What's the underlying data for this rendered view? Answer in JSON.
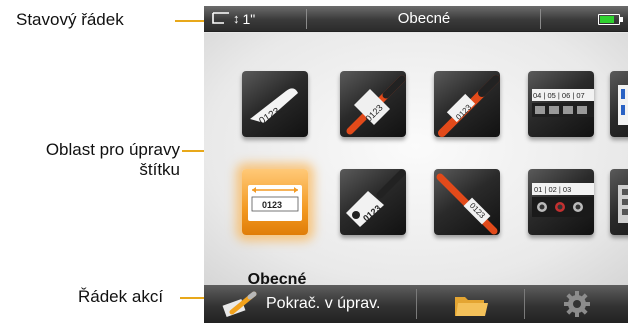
{
  "callouts": {
    "status_bar": "Stavový řádek",
    "edit_area_line1": "Oblast pro úpravy",
    "edit_area_line2": "štítku",
    "action_bar": "Řádek akcí"
  },
  "status_bar": {
    "label_indicator": "1\"",
    "title": "Obecné",
    "battery_level": 0.85
  },
  "edit_area": {
    "selected_caption": "Obecné",
    "tiles": [
      {
        "name": "flag-label-tile",
        "text": "0123..."
      },
      {
        "name": "flag-wrap-tile",
        "text": "0123"
      },
      {
        "name": "cable-wrap-tile",
        "text": "0123"
      },
      {
        "name": "patch-panel-tile",
        "text": "04 | 05 | 06 | 07"
      },
      {
        "name": "punch-down-tile",
        "text": ""
      },
      {
        "name": "general-tile",
        "text": "0123"
      },
      {
        "name": "flag-tag-tile",
        "text": "0123"
      },
      {
        "name": "heat-shrink-tile",
        "text": "0123"
      },
      {
        "name": "terminal-block-tile",
        "text": "01 | 02 | 03"
      },
      {
        "name": "module-tile",
        "text": ""
      }
    ]
  },
  "action_bar": {
    "continue_label": "Pokrač. v úprav."
  },
  "colors": {
    "accent": "#e8a81a",
    "selected": "#f39a22",
    "battery": "#2fd12f"
  }
}
